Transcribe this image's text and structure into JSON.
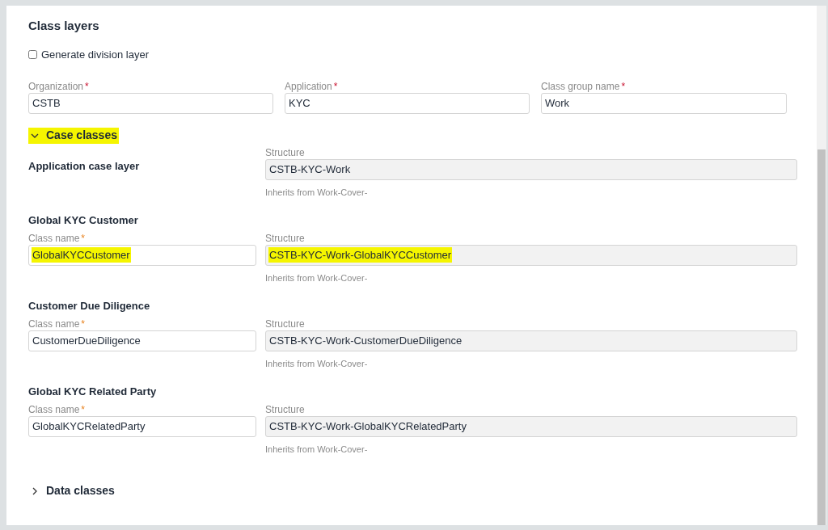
{
  "title": "Class layers",
  "division_checkbox": {
    "label": "Generate division layer",
    "checked": false
  },
  "layer_fields": [
    {
      "label": "Organization",
      "required_mark": "*",
      "value": "CSTB"
    },
    {
      "label": "Application",
      "required_mark": "*",
      "value": "KYC"
    },
    {
      "label": "Class group name",
      "required_mark": "*",
      "value": "Work"
    }
  ],
  "case_classes": {
    "label": "Case classes",
    "expanded": true,
    "highlighted": true,
    "items": [
      {
        "heading": "Application case layer",
        "structure": {
          "label": "Structure",
          "value": "CSTB-KYC-Work",
          "highlighted": false
        },
        "inherits": "Inherits from Work-Cover-"
      },
      {
        "heading": "Global KYC Customer",
        "class_name": {
          "label": "Class name",
          "required_mark": "*",
          "value": "GlobalKYCCustomer",
          "highlighted": true
        },
        "structure": {
          "label": "Structure",
          "value": "CSTB-KYC-Work-GlobalKYCCustomer",
          "highlighted": true
        },
        "inherits": "Inherits from Work-Cover-"
      },
      {
        "heading": "Customer Due Diligence",
        "class_name": {
          "label": "Class name",
          "required_mark": "*",
          "value": "CustomerDueDiligence",
          "highlighted": false
        },
        "structure": {
          "label": "Structure",
          "value": "CSTB-KYC-Work-CustomerDueDiligence",
          "highlighted": false
        },
        "inherits": "Inherits from Work-Cover-"
      },
      {
        "heading": "Global KYC Related Party",
        "class_name": {
          "label": "Class name",
          "required_mark": "*",
          "value": "GlobalKYCRelatedParty",
          "highlighted": false
        },
        "structure": {
          "label": "Structure",
          "value": "CSTB-KYC-Work-GlobalKYCRelatedParty",
          "highlighted": false
        },
        "inherits": "Inherits from Work-Cover-"
      }
    ]
  },
  "data_classes": {
    "label": "Data classes",
    "expanded": false
  }
}
